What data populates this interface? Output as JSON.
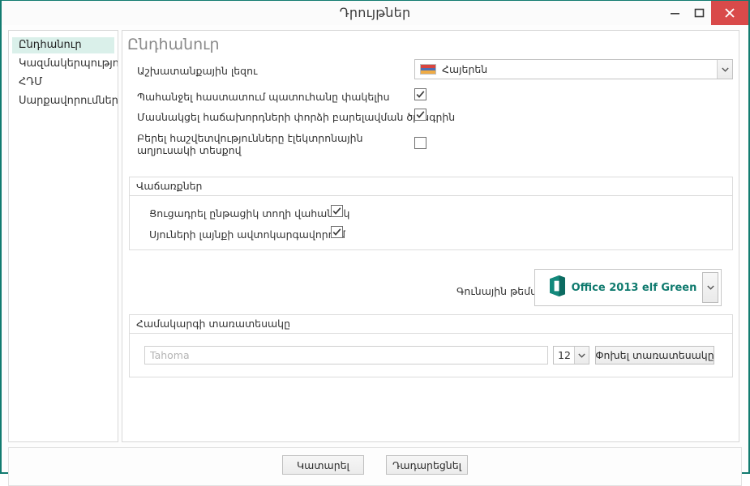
{
  "window": {
    "title": "Դրույթներ",
    "controls": {
      "minimize": "minimize-icon",
      "maximize": "maximize-icon",
      "close": "close-icon"
    },
    "accent_color": "#127b70",
    "close_color": "#d94a4a"
  },
  "sidebar": {
    "items": [
      {
        "label": "Ընդհանուր",
        "selected": true
      },
      {
        "label": "Կազմակերպություն",
        "selected": false
      },
      {
        "label": "ՀԴՄ",
        "selected": false
      },
      {
        "label": "Սարքավորումներ",
        "selected": false
      }
    ],
    "selected_bg": "#daf0ea"
  },
  "main": {
    "title": "Ընդհանուր",
    "language": {
      "label": "Աշխատանքային լեզու",
      "value": "Հայերեն",
      "flag": "armenia-flag-icon",
      "flag_colors": [
        "#d8443f",
        "#4b6fb5",
        "#efab44"
      ]
    },
    "checkboxes": [
      {
        "label": "Պահանջել հաստատում պատուհանը փակելիս",
        "checked": true
      },
      {
        "label": "Մասնակցել հաճախորդների փորձի բարելավման ծրագրին",
        "checked": true
      },
      {
        "label": "Բերել հաշվետվությունները էլեկտրոնային\n աղյուսակի տեսքով",
        "checked": false
      }
    ],
    "sales_group": {
      "title": "Վաճառքներ",
      "checkboxes": [
        {
          "label": "Ցուցադրել ընթացիկ տողի վահանակ",
          "checked": true
        },
        {
          "label": "Սյուների լայնքի ավտոկարգավորում",
          "checked": true
        }
      ]
    },
    "theme": {
      "label": "Գունային թեմա",
      "value": "Office 2013 elf Green",
      "icon": "office-logo-icon",
      "color": "#0f7a6e"
    },
    "font_group": {
      "title": "Համակարգի տառատեսակը",
      "font_name_placeholder": "Tahoma",
      "font_name_value": "",
      "font_size": "12",
      "change_button": "Փոխել տառատեսակը"
    }
  },
  "footer": {
    "apply_label": "Կատարել",
    "cancel_label": "Դադարեցնել"
  }
}
